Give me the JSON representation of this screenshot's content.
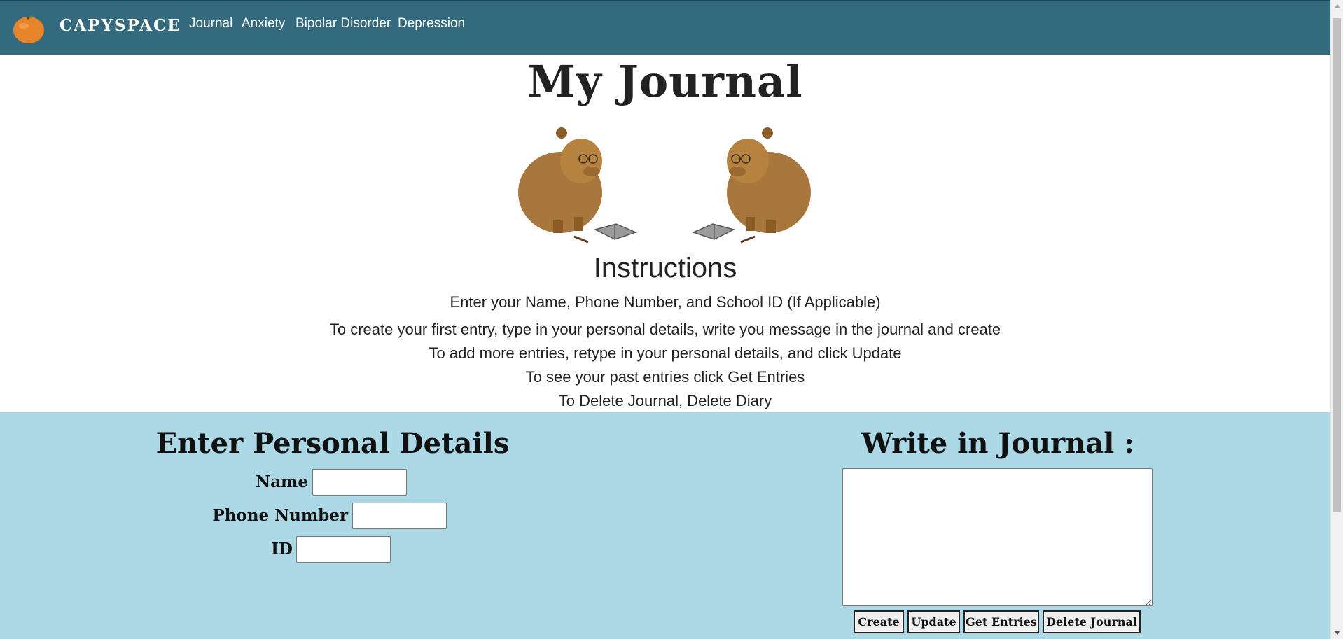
{
  "navbar": {
    "brand": "CAPYSPACE",
    "links": [
      {
        "label": "Journal"
      },
      {
        "label": "Anxiety"
      },
      {
        "label": "Bipolar Disorder"
      },
      {
        "label": "Depression"
      }
    ],
    "background_color": "#346a7e",
    "logo_icon": "orange-fruit-icon"
  },
  "page_title": "My Journal",
  "instructions": {
    "heading": "Instructions",
    "lines": [
      "Enter your Name, Phone Number, and School ID (If Applicable)",
      "To create your first entry, type in your personal details, write you message in the journal and create",
      "To add more entries, retype in your personal details, and click Update",
      "To see your past entries click Get Entries",
      "To Delete Journal, Delete Diary"
    ]
  },
  "personal_details": {
    "heading": "Enter Personal Details",
    "fields": [
      {
        "label": "Name",
        "value": ""
      },
      {
        "label": "Phone Number",
        "value": ""
      },
      {
        "label": "ID",
        "value": ""
      }
    ]
  },
  "journal": {
    "heading": "Write in Journal :",
    "content": "",
    "buttons": [
      {
        "label": "Create"
      },
      {
        "label": "Update"
      },
      {
        "label": "Get Entries"
      },
      {
        "label": "Delete Journal"
      }
    ]
  },
  "colors": {
    "panel_background": "#add8e6",
    "page_background": "#ffffff"
  }
}
